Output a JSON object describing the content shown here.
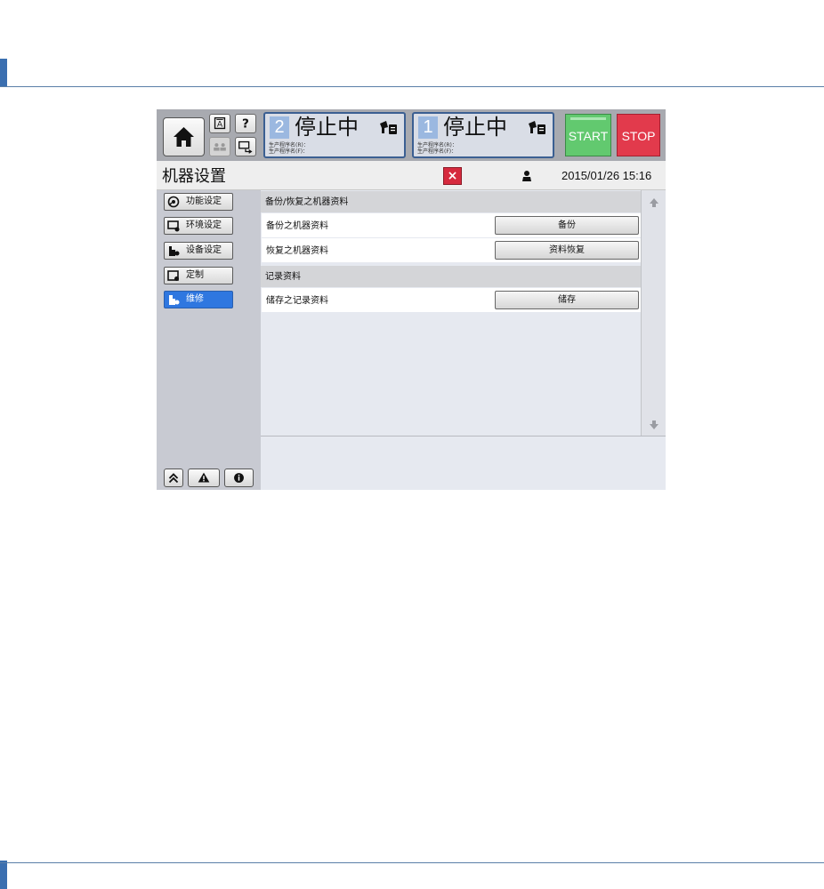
{
  "header": {
    "status_panels": [
      {
        "number": "2",
        "status": "停止中",
        "sub_line1": "生产程序名(R)：",
        "sub_line2": "生产程序名(F)："
      },
      {
        "number": "1",
        "status": "停止中",
        "sub_line1": "生产程序名(R)：",
        "sub_line2": "生产程序名(F)："
      }
    ],
    "start_label": "START",
    "stop_label": "STOP"
  },
  "title_bar": {
    "title": "机器设置",
    "close_glyph": "×",
    "datetime": "2015/01/26 15:16"
  },
  "sidebar": {
    "items": [
      {
        "label": "功能设定",
        "icon": "function-settings-icon",
        "active": false
      },
      {
        "label": "环境设定",
        "icon": "environment-settings-icon",
        "active": false
      },
      {
        "label": "设备设定",
        "icon": "equipment-settings-icon",
        "active": false
      },
      {
        "label": "定制",
        "icon": "customize-icon",
        "active": false
      },
      {
        "label": "维修",
        "icon": "maintenance-icon",
        "active": true
      }
    ],
    "bottom_buttons": [
      "collapse-up-icon",
      "warning-icon",
      "info-icon"
    ]
  },
  "main": {
    "sections": [
      {
        "title": "备份/恢复之机器资料",
        "rows": [
          {
            "label": "备份之机器资料",
            "button": "备份"
          },
          {
            "label": "恢复之机器资料",
            "button": "资料恢复"
          }
        ]
      },
      {
        "title": "记录资料",
        "rows": [
          {
            "label": "储存之记录资料",
            "button": "储存"
          }
        ]
      }
    ]
  },
  "colors": {
    "accent_blue": "#2f77e0",
    "start_green": "#62c96f",
    "stop_red": "#e23a4c",
    "close_red": "#d62a3e"
  }
}
